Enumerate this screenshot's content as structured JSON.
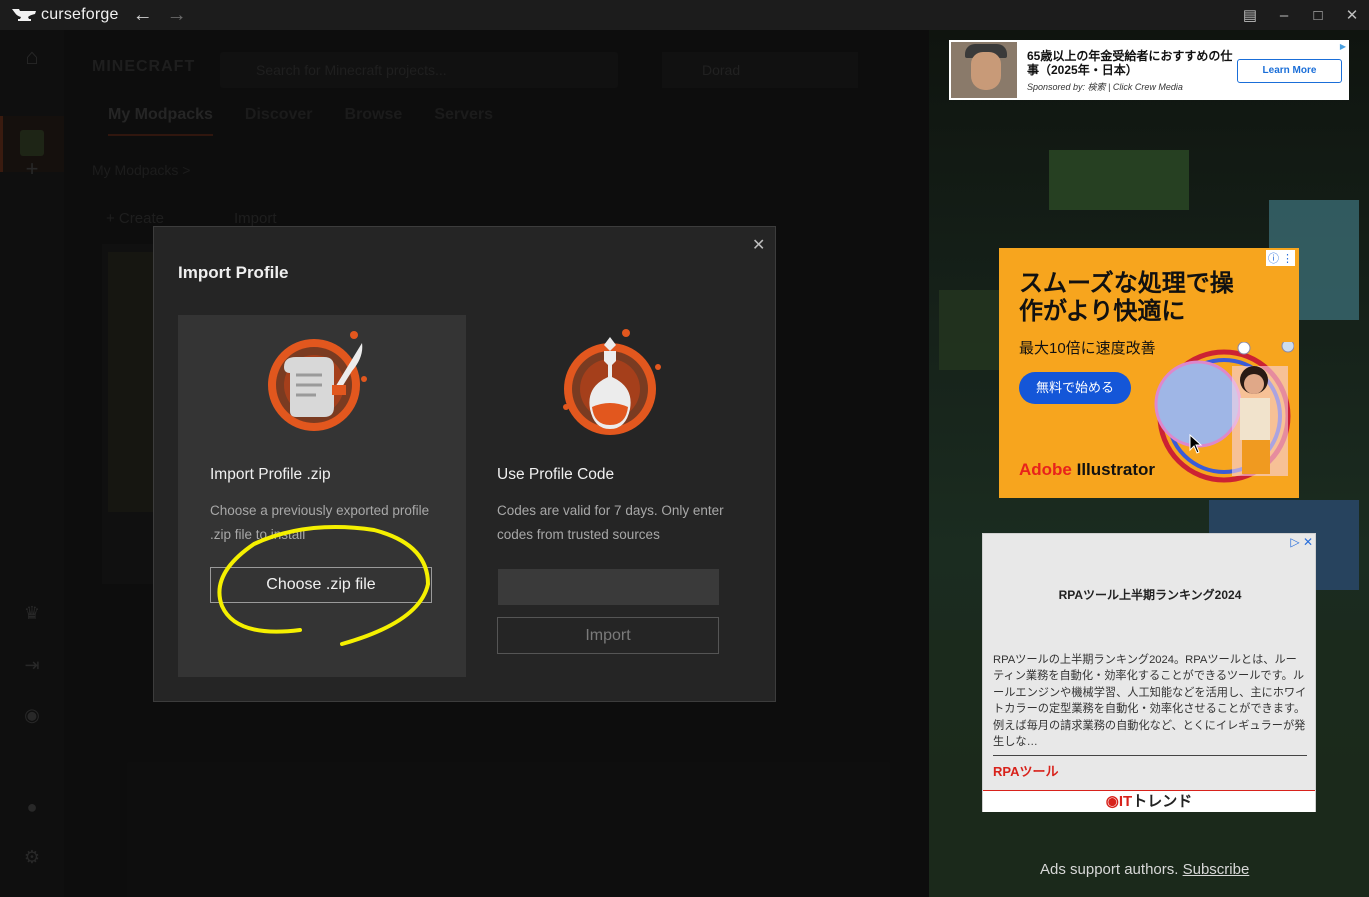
{
  "titlebar": {
    "app_name": "curseforge",
    "back_icon": "arrow-left-icon",
    "forward_icon": "arrow-right-icon",
    "window_controls": [
      "layout-icon",
      "minimize-icon",
      "maximize-icon",
      "close-icon"
    ]
  },
  "background": {
    "game_logo": "MINECRAFT",
    "search_placeholder": "Search for Minecraft projects...",
    "version_select": "Dorad",
    "tabs": [
      "My Modpacks",
      "Discover",
      "Browse",
      "Servers"
    ],
    "breadcrumb": "My Modpacks >",
    "create_label": "+ Create",
    "import_label": "Import"
  },
  "dialog": {
    "title": "Import Profile",
    "left_panel": {
      "heading": "Import Profile .zip",
      "description": "Choose a previously exported profile .zip file to install",
      "button_label": "Choose .zip file",
      "icon": "scroll-quill-icon"
    },
    "right_panel": {
      "heading": "Use Profile Code",
      "description": "Codes are valid for 7 days. Only enter codes from trusted sources",
      "input_placeholder": "",
      "button_label": "Import",
      "icon": "potion-flask-icon"
    },
    "close_icon": "close-icon"
  },
  "ads": {
    "ad1": {
      "text": "65歳以上の年金受給者におすすめの仕事（2025年・日本）",
      "sponsor": "Sponsored by: 検索 | Click Crew Media",
      "button_label": "Learn More"
    },
    "ad2": {
      "headline": "スムーズな処理で操作がより快適に",
      "subline": "最大10倍に速度改善",
      "button_label": "無料で始める",
      "brand_adobe": "Adobe",
      "brand_product": " Illustrator"
    },
    "ad3": {
      "title": "RPAツール上半期ランキング2024",
      "body": "RPAツールの上半期ランキング2024。RPAツールとは、ルーティン業務を自動化・効率化することができるツールです。ルールエンジンや機械学習、人工知能などを活用し、主にホワイトカラーの定型業務を自動化・効率化させることができます。例えば毎月の請求業務の自動化など、とくにイレギュラーが発生しな…",
      "link": "RPAツール",
      "footer_brand_red": "IT",
      "footer_brand_dark": "トレンド"
    },
    "support_text": "Ads support authors. ",
    "subscribe_link": "Subscribe"
  },
  "colors": {
    "accent": "#e2571e",
    "annotation": "#f5f000",
    "dialog_bg": "#252525"
  }
}
